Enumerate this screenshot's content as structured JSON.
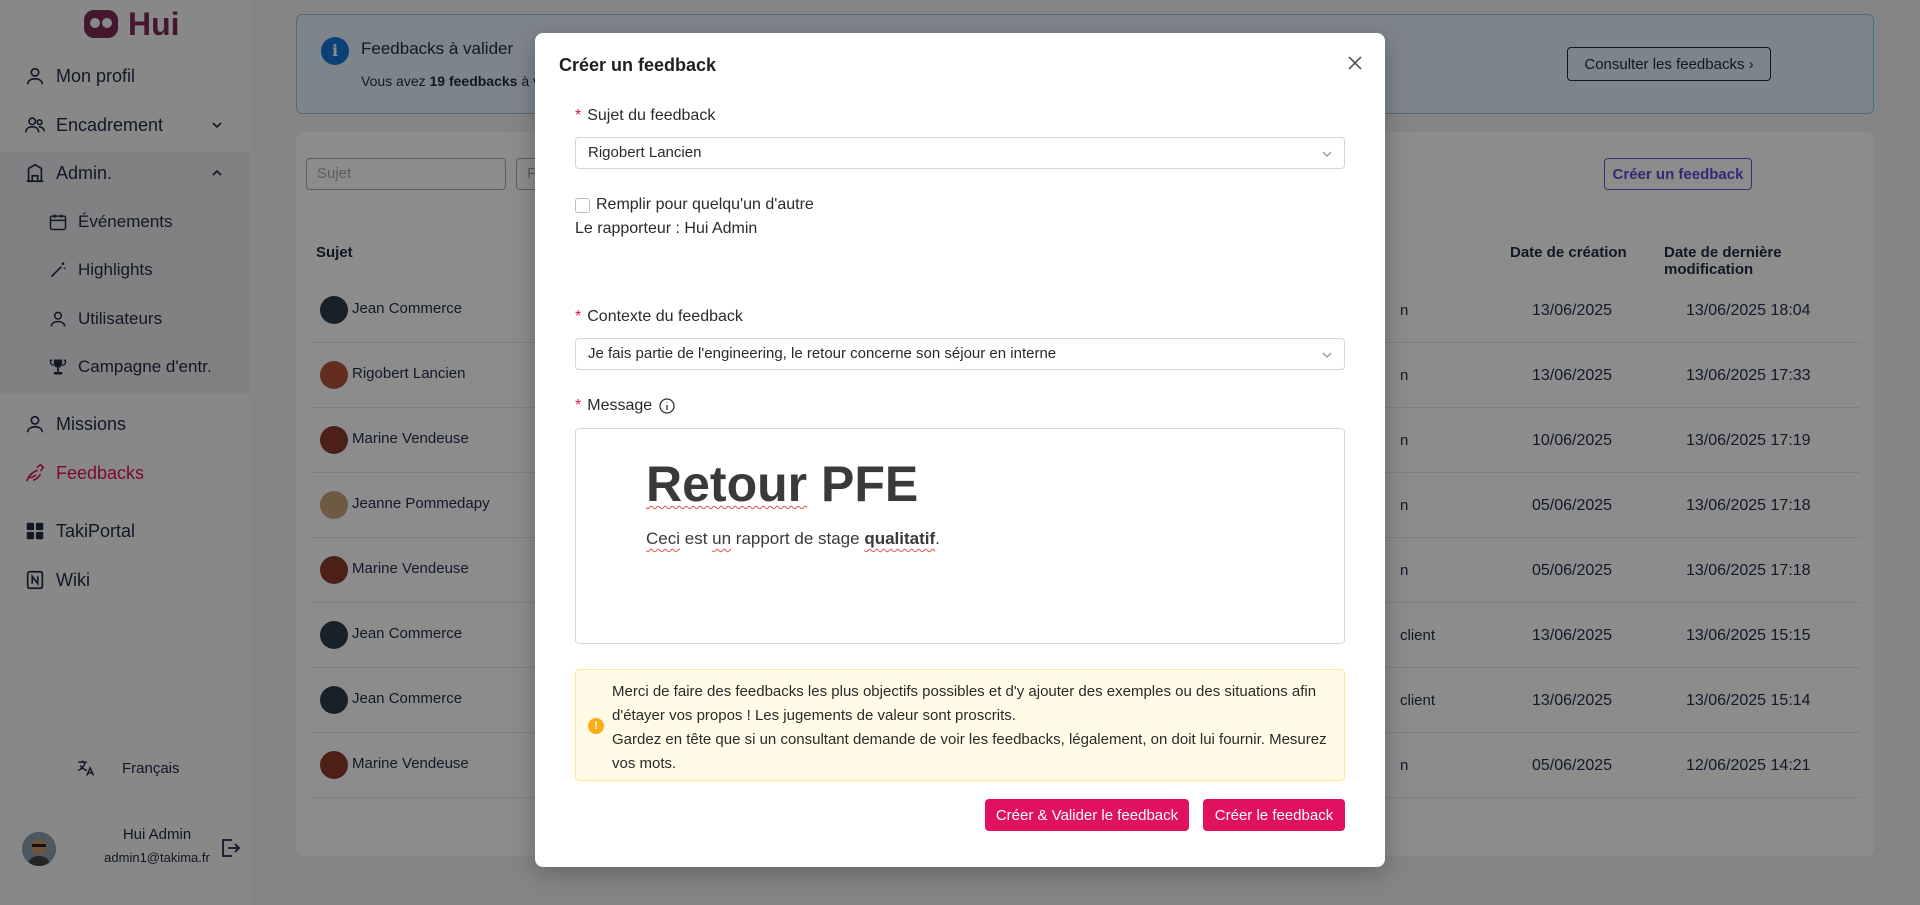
{
  "app": {
    "name": "Hui"
  },
  "sidebar": {
    "items": [
      {
        "label": "Mon profil",
        "icon": "user-icon"
      },
      {
        "label": "Encadrement",
        "icon": "users-icon"
      },
      {
        "label": "Admin.",
        "icon": "building-icon"
      },
      {
        "label": "Missions",
        "icon": "user-icon"
      },
      {
        "label": "Feedbacks",
        "icon": "feedback-icon"
      },
      {
        "label": "TakiPortal",
        "icon": "grid-icon"
      },
      {
        "label": "Wiki",
        "icon": "notion-icon"
      }
    ],
    "admin_sub": [
      {
        "label": "Événements",
        "icon": "calendar-icon"
      },
      {
        "label": "Highlights",
        "icon": "wand-icon"
      },
      {
        "label": "Utilisateurs",
        "icon": "user-icon"
      },
      {
        "label": "Campagne d'entr.",
        "icon": "trophy-icon"
      }
    ],
    "language": "Français",
    "user": {
      "name": "Hui Admin",
      "email": "admin1@takima.fr"
    }
  },
  "banner": {
    "title": "Feedbacks à valider",
    "text_prefix": "Vous avez ",
    "count": "19 feedbacks",
    "text_suffix": " à val",
    "button": "Consulter les feedbacks"
  },
  "list": {
    "filter_subject_placeholder": "Sujet",
    "filter_second_placeholder": "F",
    "create_button": "Créer un feedback",
    "headers": {
      "subject": "Sujet",
      "created": "Date de création",
      "modified": "Date de dernière modification"
    },
    "rows": [
      {
        "name": "Jean Commerce",
        "ctx": "n",
        "created": "13/06/2025",
        "modified": "13/06/2025 18:04"
      },
      {
        "name": "Rigobert Lancien",
        "ctx": "n",
        "created": "13/06/2025",
        "modified": "13/06/2025 17:33"
      },
      {
        "name": "Marine Vendeuse",
        "ctx": "n",
        "created": "10/06/2025",
        "modified": "13/06/2025 17:19"
      },
      {
        "name": "Jeanne Pommedapy",
        "ctx": "n",
        "created": "05/06/2025",
        "modified": "13/06/2025 17:18"
      },
      {
        "name": "Marine Vendeuse",
        "ctx": "n",
        "created": "05/06/2025",
        "modified": "13/06/2025 17:18"
      },
      {
        "name": "Jean Commerce",
        "ctx": "client",
        "created": "13/06/2025",
        "modified": "13/06/2025 15:15"
      },
      {
        "name": "Jean Commerce",
        "ctx": "client",
        "created": "13/06/2025",
        "modified": "13/06/2025 15:14"
      },
      {
        "name": "Marine Vendeuse",
        "ctx": "n",
        "created": "05/06/2025",
        "modified": "12/06/2025 14:21"
      }
    ]
  },
  "modal": {
    "title": "Créer un feedback",
    "subject_label": "Sujet du feedback",
    "subject_value": "Rigobert Lancien",
    "checkbox_label": "Remplir pour quelqu'un d'autre",
    "reporter": "Le rapporteur : Hui Admin",
    "context_label": "Contexte du feedback",
    "context_value": "Je fais partie de l'engineering, le retour concerne son séjour en interne",
    "message_label": "Message",
    "editor": {
      "h1_word1": "Retour",
      "h1_word2": " PFE",
      "p_w1": "Ceci",
      "p_w2": " est ",
      "p_w3": "un",
      "p_w4": " rapport de stage ",
      "p_bold": "qualitatif",
      "p_end": "."
    },
    "alert_line1": "Merci de faire des feedbacks les plus objectifs possibles et d'y ajouter des exemples ou des situations afin d'étayer vos propos ! Les jugements de valeur sont proscrits.",
    "alert_line2": "Gardez en tête que si un consultant demande de voir les feedbacks, légalement, on doit lui fournir. Mesurez vos mots.",
    "btn_create_validate": "Créer & Valider le feedback",
    "btn_create": "Créer le feedback"
  },
  "colors": {
    "accent": "#e0115f",
    "brand": "#7e2b55",
    "info": "#1677d8"
  }
}
